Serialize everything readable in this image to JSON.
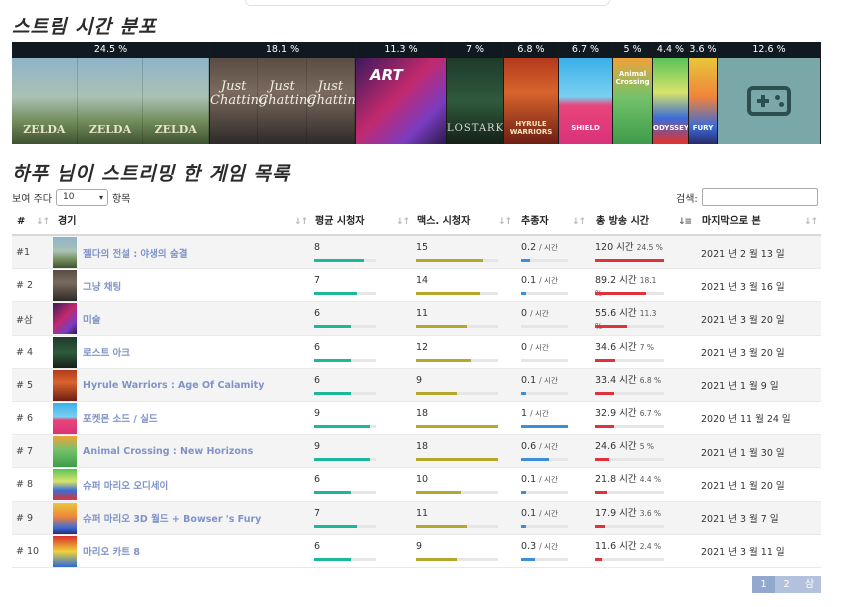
{
  "header": {
    "distribution_title": "스트림 시간 분포",
    "list_title": "하푸 님이 스트리밍 한 게임 목록"
  },
  "distribution": [
    {
      "pct": 24.5,
      "label": "24.5 %",
      "art": "zelda",
      "art_text": "ZELDA"
    },
    {
      "pct": 18.1,
      "label": "18.1 %",
      "art": "chatting",
      "art_text": "Just Chatting"
    },
    {
      "pct": 11.3,
      "label": "11.3 %",
      "art": "art",
      "art_text": "ART"
    },
    {
      "pct": 7.0,
      "label": "7 %",
      "art": "lostark",
      "art_text": "LOSTARK"
    },
    {
      "pct": 6.8,
      "label": "6.8 %",
      "art": "hyrule",
      "art_text": "HYRULE WARRIORS"
    },
    {
      "pct": 6.7,
      "label": "6.7 %",
      "art": "pokemon",
      "art_text": "SHIELD"
    },
    {
      "pct": 5.0,
      "label": "5 %",
      "art": "animal",
      "art_text": "Animal Crossing"
    },
    {
      "pct": 4.4,
      "label": "4.4 %",
      "art": "odyssey",
      "art_text": "ODYSSEY"
    },
    {
      "pct": 3.6,
      "label": "3.6 %",
      "art": "mario3d",
      "art_text": "FURY"
    },
    {
      "pct": 12.6,
      "label": "12.6 %",
      "art": "other",
      "art_text": ""
    }
  ],
  "controls": {
    "length_prefix": "보여 주다",
    "length_value": "10",
    "length_suffix": "항목",
    "search_label": "검색:"
  },
  "columns": {
    "rank": "#",
    "game": "경기",
    "avg_viewers": "평균 시청자",
    "max_viewers": "맥스. 시청자",
    "followers": "추종자",
    "total_time": "총 방송 시간",
    "last_seen": "마지막으로 본"
  },
  "colors": {
    "avg": "#1bb99a",
    "max": "#b5a72a",
    "followers": "#3b8fd9",
    "time": "#e0323a",
    "link": "#7f93c8"
  },
  "rows": [
    {
      "rank": "#1",
      "game": "젤다의 전설 : 야생의 숨결",
      "avg": "8",
      "avg_frac": 0.8,
      "max": "15",
      "max_frac": 0.82,
      "fol": "0.2",
      "fol_frac": 0.2,
      "time": "120 시간",
      "time_pct": "24.5 %",
      "time_frac": 1.0,
      "last": "2021 년 2 월 13 일",
      "thumb": "zelda"
    },
    {
      "rank": "# 2",
      "game": "그냥 채팅",
      "avg": "7",
      "avg_frac": 0.7,
      "max": "14",
      "max_frac": 0.78,
      "fol": "0.1",
      "fol_frac": 0.1,
      "time": "89.2 시간",
      "time_pct": "18.1 %",
      "time_frac": 0.74,
      "last": "2021 년 3 월 16 일",
      "thumb": "chatting"
    },
    {
      "rank": "#삼",
      "game": "미술",
      "avg": "6",
      "avg_frac": 0.6,
      "max": "11",
      "max_frac": 0.62,
      "fol": "0",
      "fol_frac": 0.0,
      "time": "55.6 시간",
      "time_pct": "11.3 %",
      "time_frac": 0.46,
      "last": "2021 년 3 월 20 일",
      "thumb": "art"
    },
    {
      "rank": "# 4",
      "game": "로스트 아크",
      "avg": "6",
      "avg_frac": 0.6,
      "max": "12",
      "max_frac": 0.67,
      "fol": "0",
      "fol_frac": 0.0,
      "time": "34.6 시간",
      "time_pct": "7 %",
      "time_frac": 0.29,
      "last": "2021 년 3 월 20 일",
      "thumb": "lostark"
    },
    {
      "rank": "# 5",
      "game": "Hyrule Warriors : Age Of Calamity",
      "avg": "6",
      "avg_frac": 0.6,
      "max": "9",
      "max_frac": 0.5,
      "fol": "0.1",
      "fol_frac": 0.1,
      "time": "33.4 시간",
      "time_pct": "6.8 %",
      "time_frac": 0.28,
      "last": "2021 년 1 월 9 일",
      "thumb": "hyrule"
    },
    {
      "rank": "# 6",
      "game": "포켓몬 소드 / 실드",
      "avg": "9",
      "avg_frac": 0.9,
      "max": "18",
      "max_frac": 1.0,
      "fol": "1",
      "fol_frac": 1.0,
      "time": "32.9 시간",
      "time_pct": "6.7 %",
      "time_frac": 0.27,
      "last": "2020 년 11 월 24 일",
      "thumb": "pokemon"
    },
    {
      "rank": "# 7",
      "game": "Animal Crossing : New Horizons",
      "avg": "9",
      "avg_frac": 0.9,
      "max": "18",
      "max_frac": 1.0,
      "fol": "0.6",
      "fol_frac": 0.6,
      "time": "24.6 시간",
      "time_pct": "5 %",
      "time_frac": 0.2,
      "last": "2021 년 1 월 30 일",
      "thumb": "animal"
    },
    {
      "rank": "# 8",
      "game": "슈퍼 마리오 오디세이",
      "avg": "6",
      "avg_frac": 0.6,
      "max": "10",
      "max_frac": 0.55,
      "fol": "0.1",
      "fol_frac": 0.1,
      "time": "21.8 시간",
      "time_pct": "4.4 %",
      "time_frac": 0.18,
      "last": "2021 년 1 월 20 일",
      "thumb": "odyssey"
    },
    {
      "rank": "# 9",
      "game": "슈퍼 마리오 3D 월드 + Bowser 's Fury",
      "avg": "7",
      "avg_frac": 0.7,
      "max": "11",
      "max_frac": 0.62,
      "fol": "0.1",
      "fol_frac": 0.1,
      "time": "17.9 시간",
      "time_pct": "3.6 %",
      "time_frac": 0.15,
      "last": "2021 년 3 월 7 일",
      "thumb": "mario3d"
    },
    {
      "rank": "# 10",
      "game": "마리오 카트 8",
      "avg": "6",
      "avg_frac": 0.6,
      "max": "9",
      "max_frac": 0.5,
      "fol": "0.3",
      "fol_frac": 0.3,
      "time": "11.6 시간",
      "time_pct": "2.4 %",
      "time_frac": 0.1,
      "last": "2021 년 3 월 11 일",
      "thumb": "kart"
    }
  ],
  "units": {
    "per_hour": "/ 시간"
  },
  "pagination": [
    "1",
    "2",
    "삼"
  ]
}
